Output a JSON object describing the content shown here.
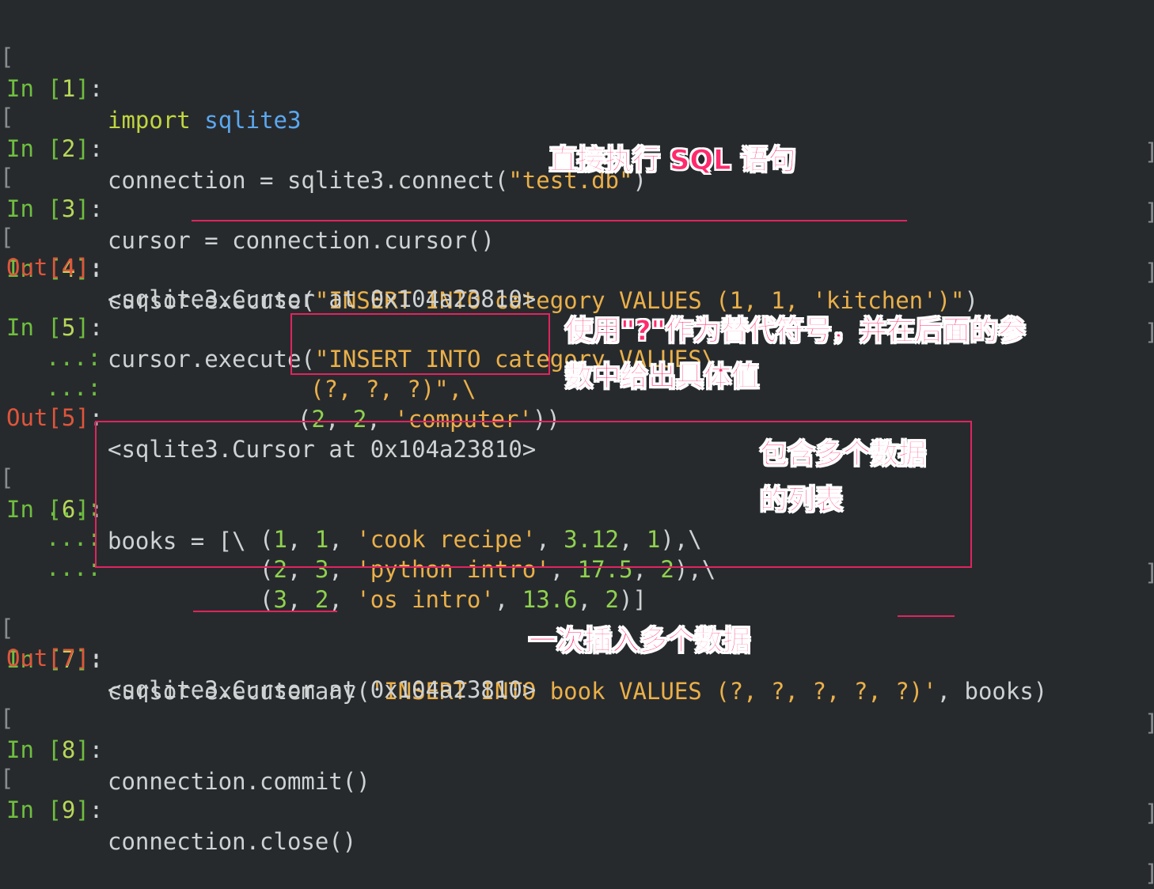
{
  "cells": [
    {
      "in_label": "In",
      "num": "1",
      "code": [
        "import",
        " ",
        "sqlite3"
      ]
    },
    {
      "in_label": "In",
      "num": "2",
      "code": "connection = sqlite3.connect(",
      "str": "\"test.db\"",
      "tail": ")"
    },
    {
      "in_label": "In",
      "num": "3",
      "code": "cursor = connection.cursor()"
    },
    {
      "in_label": "In",
      "num": "4",
      "code": "cursor.execute(",
      "str": "\"INSERT INTO category VALUES (1, 1, 'kitchen')\"",
      "tail": ")",
      "out_label": "Out",
      "out": "<sqlite3.Cursor at 0x104a23810>"
    },
    {
      "in_label": "In",
      "num": "5",
      "code": "cursor.execute(",
      "str": "\"INSERT INTO category VALUES\\",
      "cont1": "(?, ?, ?)\",\\",
      "cont2_a": "(",
      "cont2_n1": "2",
      "cont2_sep": ", ",
      "cont2_n2": "2",
      "cont2_s": "'computer'",
      "cont2_end": "))",
      "out_label": "Out",
      "out": "<sqlite3.Cursor at 0x104a23810>"
    },
    {
      "in_label": "In",
      "num": "6",
      "code": "books = [\\",
      "rows": [
        {
          "a": "1",
          "b": "1",
          "s": "'cook recipe'",
          "p": "3.12",
          "c": "1",
          "end": "),\\"
        },
        {
          "a": "2",
          "b": "3",
          "s": "'python intro'",
          "p": "17.5",
          "c": "2",
          "end": "),\\"
        },
        {
          "a": "3",
          "b": "2",
          "s": "'os intro'",
          "p": "13.6",
          "c": "2",
          "end": ")]"
        }
      ]
    },
    {
      "in_label": "In",
      "num": "7",
      "code": "cursor.executemany(",
      "str": "'INSERT INTO book VALUES (?, ?, ?, ?, ?)'",
      "tail": ", books)",
      "out_label": "Out",
      "out": "<sqlite3.Cursor at 0x104a23810>"
    },
    {
      "in_label": "In",
      "num": "8",
      "code": "connection.commit()"
    },
    {
      "in_label": "In",
      "num": "9",
      "code": "connection.close()"
    }
  ],
  "continuation": "...:",
  "annotations": {
    "direct_sql": "直接执行 SQL 语句",
    "placeholder_1": "使用\"?\"作为替代符号，并在后面的参",
    "placeholder_2": "数中给出具体值",
    "list_1": "包含多个数据",
    "list_2": "的列表",
    "insert_many": "一次插入多个数据"
  },
  "colors": {
    "background": "#272a2d",
    "annotation": "#ff2a6d",
    "box": "#e0245e"
  }
}
